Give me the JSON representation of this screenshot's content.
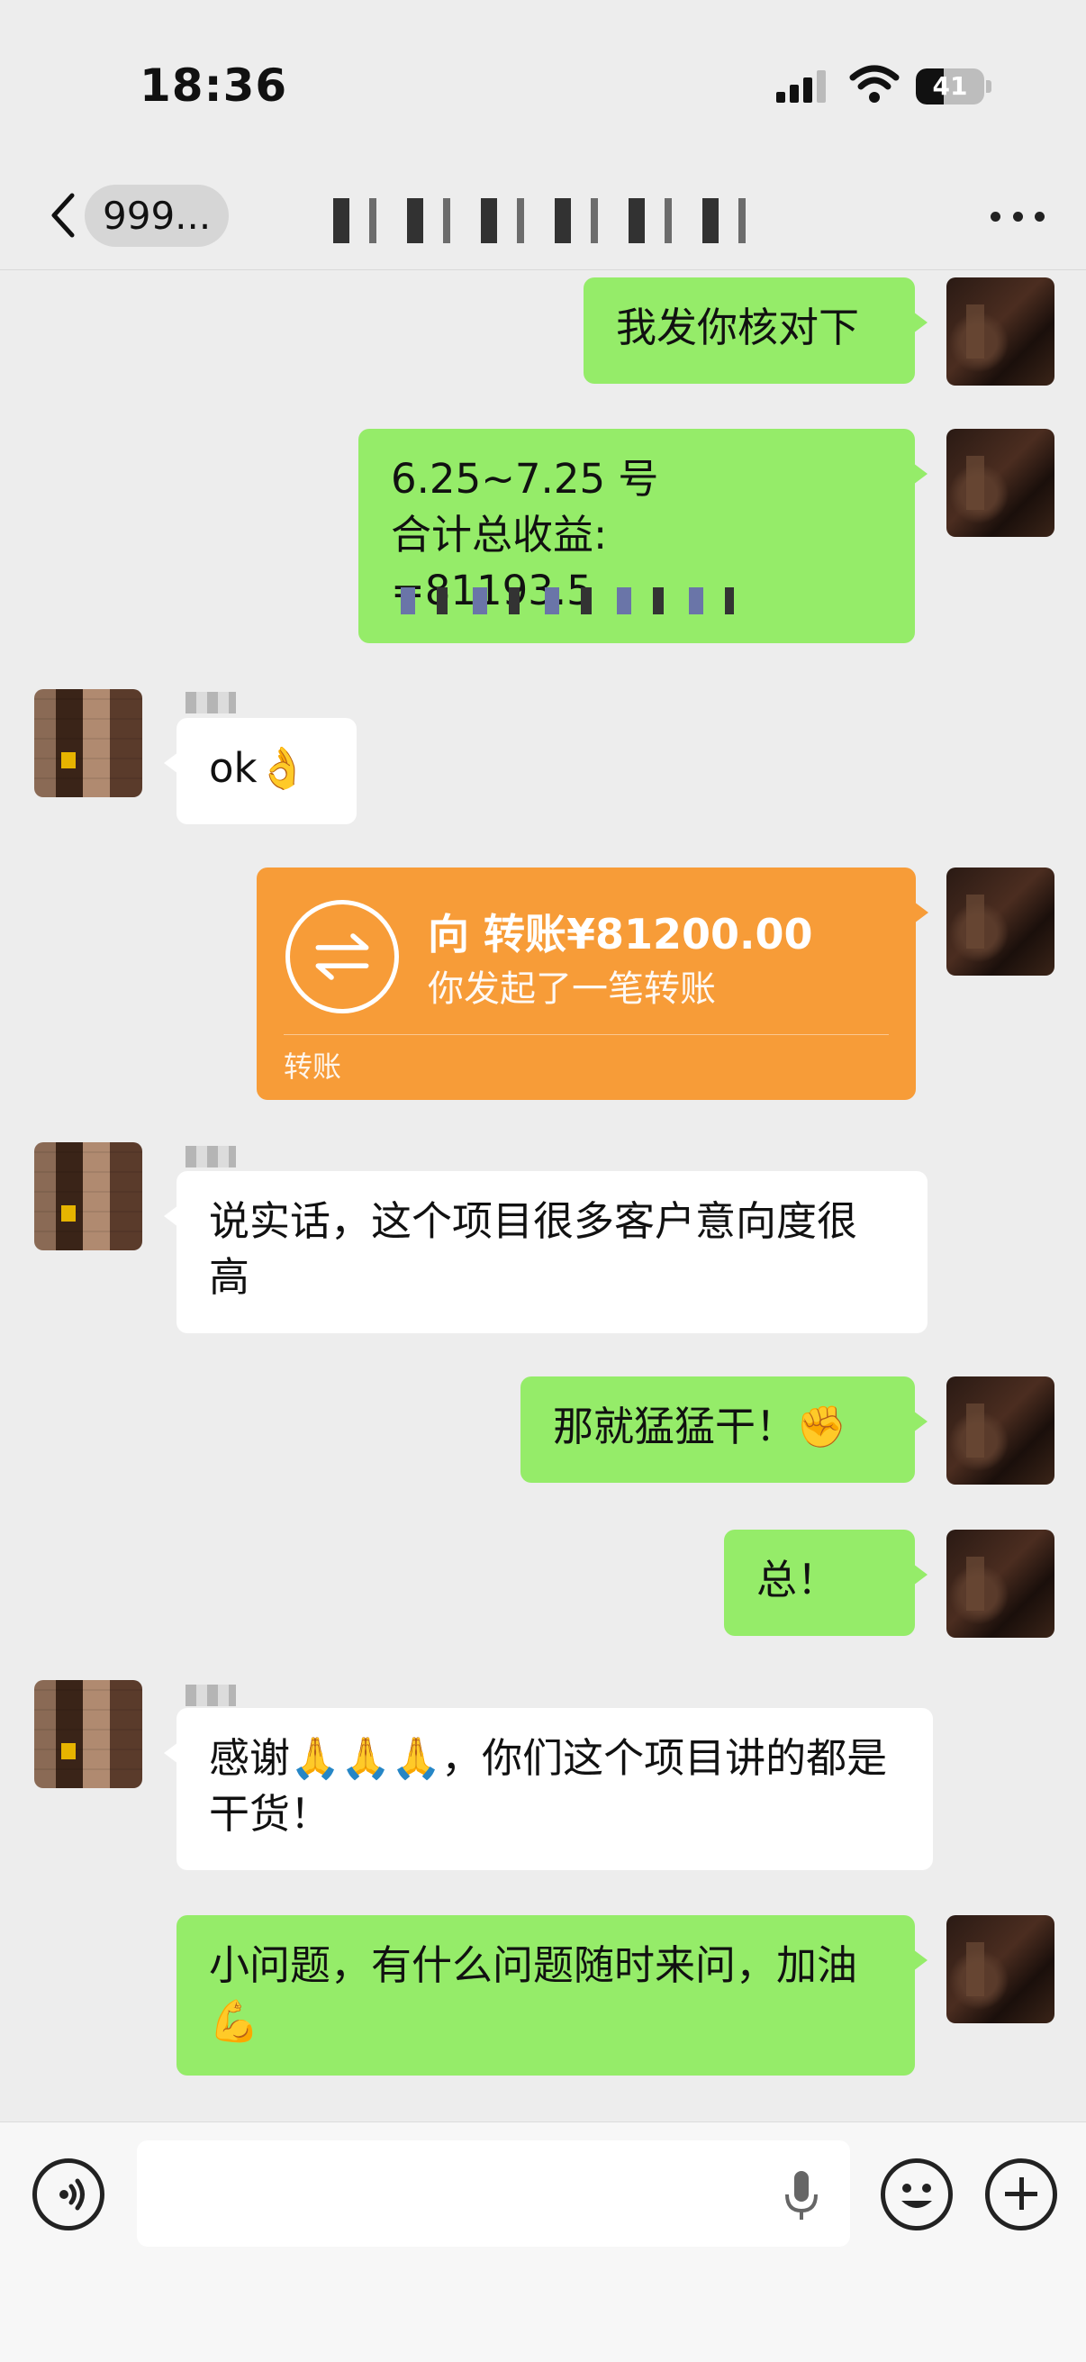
{
  "status_bar": {
    "time": "18:36",
    "battery": "41",
    "battery_level": 0.41
  },
  "nav": {
    "back_label": "999...",
    "title": ""
  },
  "messages": [
    {
      "from": "me",
      "text": "我发你核对下"
    },
    {
      "from": "me",
      "text": "6.25~7.25 号\n合计总收益:\n=81193.5"
    },
    {
      "from": "friend",
      "text": "ok👌"
    },
    {
      "from": "me",
      "type": "transfer",
      "title": "向      转账¥81200.00",
      "subtitle": "你发起了一笔转账",
      "footer": "转账"
    },
    {
      "from": "friend",
      "text": "说实话，这个项目很多客户意向度很高"
    },
    {
      "from": "me",
      "text": "那就猛猛干！✊"
    },
    {
      "from": "me",
      "text": "总！"
    },
    {
      "from": "friend",
      "text": "感谢🙏🙏🙏，你们这个项目讲的都是干货！"
    },
    {
      "from": "me",
      "text": "小问题，有什么问题随时来问，加油💪"
    }
  ],
  "input": {
    "placeholder": ""
  },
  "icons": {
    "back": "chevron-left-icon",
    "more": "more-dots-icon",
    "voice": "voice-icon",
    "mic": "mic-icon",
    "emoji": "emoji-icon",
    "plus": "plus-icon",
    "transfer": "transfer-arrows-icon"
  },
  "colors": {
    "my_bubble": "#95ec69",
    "friend_bubble": "#ffffff",
    "transfer_card": "#f79c38",
    "background": "#ededed"
  }
}
